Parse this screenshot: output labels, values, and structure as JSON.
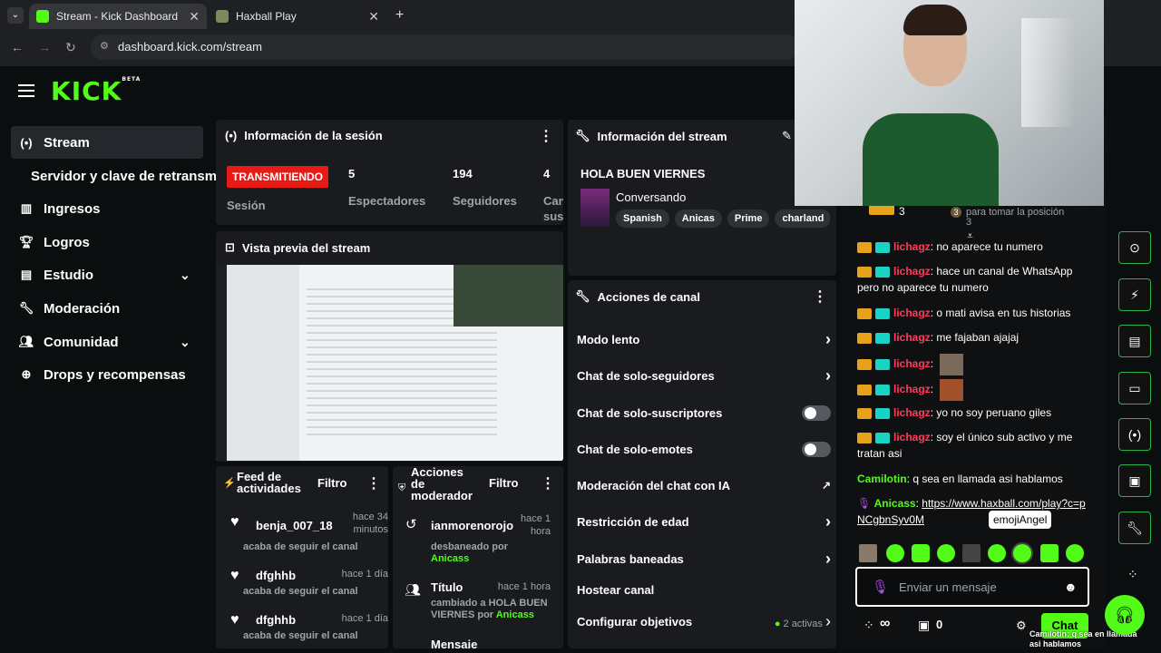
{
  "browser": {
    "tabs": [
      {
        "label": "Stream - Kick Dashboard"
      },
      {
        "label": "Haxball Play"
      }
    ],
    "url": "dashboard.kick.com/stream"
  },
  "logo": {
    "text": "KICK",
    "beta": "BETA"
  },
  "sidebar": {
    "items": [
      {
        "label": "Stream",
        "icon": "broadcast-icon"
      },
      {
        "label": "Servidor y clave de retransm",
        "icon": ""
      },
      {
        "label": "Ingresos",
        "icon": "chart-icon"
      },
      {
        "label": "Logros",
        "icon": "trophy-icon"
      },
      {
        "label": "Estudio",
        "icon": "studio-icon"
      },
      {
        "label": "Moderación",
        "icon": "wrench-icon"
      },
      {
        "label": "Comunidad",
        "icon": "users-icon"
      },
      {
        "label": "Drops y recompensas",
        "icon": "gift-icon"
      }
    ]
  },
  "session": {
    "title": "Información de la sesión",
    "status": "TRANSMITIENDO",
    "session_label": "Sesión",
    "viewers": "5",
    "viewers_label": "Espectadores",
    "followers": "194",
    "followers_label": "Seguidores",
    "cam": "4",
    "cam_label1": "Can",
    "cam_label2": "sus"
  },
  "preview": {
    "title": "Vista previa del stream"
  },
  "streaminfo": {
    "title": "Información del stream",
    "stream_title": "HOLA BUEN VIERNES",
    "category": "Conversando",
    "tags": [
      "Spanish",
      "Anicas",
      "Prime",
      "charland"
    ]
  },
  "channel": {
    "title": "Acciones de canal",
    "rows": [
      {
        "label": "Modo lento"
      },
      {
        "label": "Chat de solo-seguidores"
      },
      {
        "label": "Chat de solo-suscriptores"
      },
      {
        "label": "Chat de solo-emotes"
      },
      {
        "label": "Moderación del chat con IA"
      },
      {
        "label": "Restricción de edad"
      },
      {
        "label": "Palabras baneadas"
      },
      {
        "label": "Hostear canal"
      },
      {
        "label": "Configurar objetivos"
      }
    ],
    "goals_status": "2 activas"
  },
  "feed": {
    "title1": "Feed de",
    "title2": "actividades",
    "filter": "Filtro",
    "items": [
      {
        "user": "benja_007_18",
        "time1": "hace 34",
        "time2": "minutos",
        "action": "acaba de seguir el canal"
      },
      {
        "user": "dfghhb",
        "time1": "hace 1 día",
        "time2": "",
        "action": "acaba de seguir el canal"
      },
      {
        "user": "dfghhb",
        "time1": "hace 1 día",
        "time2": "",
        "action": "acaba de seguir el canal"
      }
    ]
  },
  "modactions": {
    "title1": "Acciones",
    "title2": "de",
    "title3": "moderador",
    "filter": "Filtro",
    "items": [
      {
        "user": "ianmorenorojo",
        "time1": "hace 1",
        "time2": "hora",
        "line1": "desbaneado por",
        "line2": "Anicass"
      },
      {
        "user": "Título",
        "time1": "hace 1 hora",
        "line1": "cambiado a HOLA BUEN",
        "line2": "VIERNES por",
        "line3": "Anicass"
      },
      {
        "user": "Mensaje"
      }
    ]
  },
  "chat": {
    "top_count": "3",
    "top_rank": "3",
    "top_text": "para tomar la posición",
    "top_text2": "3",
    "messages": [
      {
        "user": "lichagz",
        "text": "no aparece tu numero"
      },
      {
        "user": "lichagz",
        "text": "hace un canal de WhatsApp pero no aparece tu numero"
      },
      {
        "user": "lichagz",
        "text": "o mati avisa en tus historias"
      },
      {
        "user": "lichagz",
        "text": "me fajaban ajajaj"
      },
      {
        "user": "lichagz",
        "text": ""
      },
      {
        "user": "lichagz",
        "text": ""
      },
      {
        "user": "lichagz",
        "text": "yo no soy peruano giles"
      },
      {
        "user": "lichagz",
        "text": "soy el único sub activo y me tratan asi"
      },
      {
        "user": "Camilotin",
        "text": "q sea en llamada asi hablamos"
      },
      {
        "user": "Anicass",
        "text": "https://www.haxball.com/play?c=pNCgbnSyv0M"
      }
    ],
    "tooltip": "emojiAngel",
    "input_placeholder": "Enviar un mensaje",
    "points": "∞",
    "gifts": "0",
    "send": "Chat",
    "overlay": "Camilotin: q sea en llamada asi hablamos"
  },
  "colors": {
    "kick": "#53fc18",
    "live": "#e91916",
    "user_red": "#ff3b5c"
  }
}
